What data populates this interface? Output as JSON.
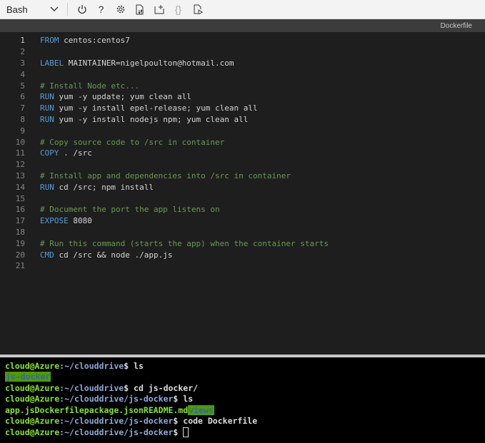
{
  "toolbar": {
    "shell": "Bash",
    "icons": [
      "power-icon",
      "help-icon",
      "settings-icon",
      "upload-download-icon",
      "new-session-icon",
      "editor-braces-icon",
      "web-preview-icon"
    ],
    "help_glyph": "?",
    "braces_glyph": "{}"
  },
  "tab": {
    "title": "Dockerfile"
  },
  "editor": {
    "lines": [
      {
        "n": "1",
        "kw": "FROM",
        "rest": " centos:centos7",
        "cm": ""
      },
      {
        "n": "2",
        "kw": "",
        "rest": "",
        "cm": ""
      },
      {
        "n": "3",
        "kw": "LABEL",
        "rest": " MAINTAINER=nigelpoulton@hotmail.com",
        "cm": ""
      },
      {
        "n": "4",
        "kw": "",
        "rest": "",
        "cm": ""
      },
      {
        "n": "5",
        "kw": "",
        "rest": "",
        "cm": "# Install Node etc..."
      },
      {
        "n": "6",
        "kw": "RUN",
        "rest": " yum -y update; yum clean all",
        "cm": ""
      },
      {
        "n": "7",
        "kw": "RUN",
        "rest": " yum -y install epel-release; yum clean all",
        "cm": ""
      },
      {
        "n": "8",
        "kw": "RUN",
        "rest": " yum -y install nodejs npm; yum clean all",
        "cm": ""
      },
      {
        "n": "9",
        "kw": "",
        "rest": "",
        "cm": ""
      },
      {
        "n": "10",
        "kw": "",
        "rest": "",
        "cm": "# Copy source code to /src in container"
      },
      {
        "n": "11",
        "kw": "COPY",
        "rest": " . /src",
        "cm": ""
      },
      {
        "n": "12",
        "kw": "",
        "rest": "",
        "cm": ""
      },
      {
        "n": "13",
        "kw": "",
        "rest": "",
        "cm": "# Install app and dependencies into /src in container"
      },
      {
        "n": "14",
        "kw": "RUN",
        "rest": " cd /src; npm install",
        "cm": ""
      },
      {
        "n": "15",
        "kw": "",
        "rest": "",
        "cm": ""
      },
      {
        "n": "16",
        "kw": "",
        "rest": "",
        "cm": "# Document the port the app listens on"
      },
      {
        "n": "17",
        "kw": "EXPOSE",
        "rest": " 8080",
        "cm": ""
      },
      {
        "n": "18",
        "kw": "",
        "rest": "",
        "cm": ""
      },
      {
        "n": "19",
        "kw": "",
        "rest": "",
        "cm": "# Run this command (starts the app) when the container starts"
      },
      {
        "n": "20",
        "kw": "CMD",
        "rest": " cd /src && node ./app.js",
        "cm": ""
      },
      {
        "n": "21",
        "kw": "",
        "rest": "",
        "cm": ""
      }
    ]
  },
  "terminal": {
    "user": "cloud@Azure",
    "p1": ":~/clouddrive",
    "p2": ":~/clouddrive/js-docker",
    "cmd1": "$ ls",
    "dir1": "js-docker",
    "cmd2": "$ cd js-docker/",
    "cmd3": "$ ls",
    "files": [
      "app.js",
      "Dockerfile",
      "package.json",
      "README.md"
    ],
    "dir2": "views",
    "cmd4": "$ code Dockerfile",
    "cmd5": "$ "
  }
}
